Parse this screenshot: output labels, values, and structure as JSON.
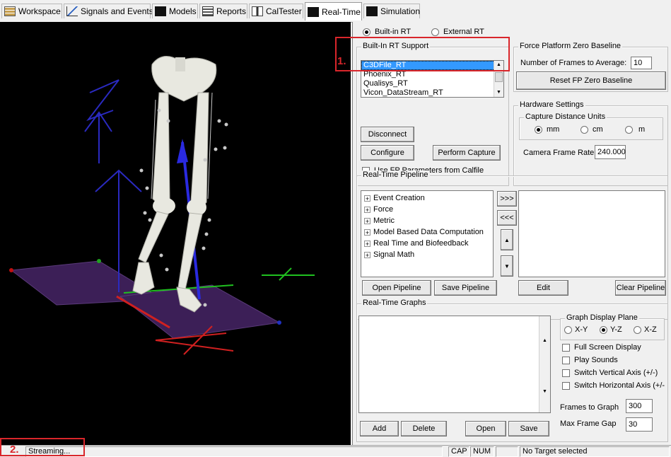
{
  "tabs": [
    {
      "label": "Workspace",
      "icon": "workspace-grid-icon"
    },
    {
      "label": "Signals and Events",
      "icon": "signals-graph-icon"
    },
    {
      "label": "Models",
      "icon": "models-figure-icon"
    },
    {
      "label": "Reports",
      "icon": "reports-grid-icon"
    },
    {
      "label": "CalTester",
      "icon": "caltester-icon"
    },
    {
      "label": "Real-Time",
      "icon": "realtime-figure-icon"
    },
    {
      "label": "Simulation",
      "icon": "simulation-icon"
    }
  ],
  "active_tab": "Real-Time",
  "rt_mode": {
    "builtin_label": "Built-in RT",
    "external_label": "External RT",
    "selected": "Built-in RT"
  },
  "builtin_support": {
    "title": "Built-In RT Support",
    "items": [
      "C3DFile_RT",
      "Phoenix_RT",
      "Qualisys_RT",
      "Vicon_DataStream_RT"
    ],
    "selected": "C3DFile_RT",
    "disconnect_label": "Disconnect",
    "configure_label": "Configure",
    "perform_capture_label": "Perform Capture",
    "fp_params_label": "Use FP Parameters from Calfile"
  },
  "fp_zero": {
    "title": "Force Platform Zero Baseline",
    "frames_label": "Number of Frames to Average:",
    "frames_value": "10",
    "reset_label": "Reset FP Zero Baseline"
  },
  "hardware": {
    "title": "Hardware Settings",
    "units_title": "Capture Distance Units",
    "units": [
      "mm",
      "cm",
      "m"
    ],
    "selected_unit": "mm",
    "frame_rate_label": "Camera Frame Rate",
    "frame_rate_value": "240.000"
  },
  "pipeline": {
    "title": "Real-Time Pipeline",
    "items": [
      "Event Creation",
      "Force",
      "Metric",
      "Model Based Data Computation",
      "Real Time and Biofeedback",
      "Signal Math"
    ],
    "add_label": ">>>",
    "remove_label": "<<<",
    "open_label": "Open Pipeline",
    "save_label": "Save Pipeline",
    "edit_label": "Edit",
    "clear_label": "Clear Pipeline"
  },
  "graphs": {
    "title": "Real-Time Graphs",
    "add_label": "Add",
    "delete_label": "Delete",
    "open_label": "Open",
    "save_label": "Save",
    "plane_title": "Graph Display Plane",
    "planes": [
      "X-Y",
      "Y-Z",
      "X-Z"
    ],
    "selected_plane": "Y-Z",
    "full_screen_label": "Full Screen Display",
    "play_sounds_label": "Play Sounds",
    "switch_vertical_label": "Switch Vertical Axis (+/-)",
    "switch_horizontal_label": "Switch Horizontal Axis (+/-",
    "frames_label": "Frames to Graph",
    "frames_value": "300",
    "gap_label": "Max Frame Gap",
    "gap_value": "30"
  },
  "status": {
    "message": "Streaming...",
    "cap": "CAP",
    "num": "NUM",
    "target": "No Target selected"
  },
  "annotations": [
    "1.",
    "2."
  ],
  "colors": {
    "highlight": "#d9262b",
    "selection": "#3399ff",
    "viewport_bg": "#000000",
    "platform": "#3c1f57"
  }
}
